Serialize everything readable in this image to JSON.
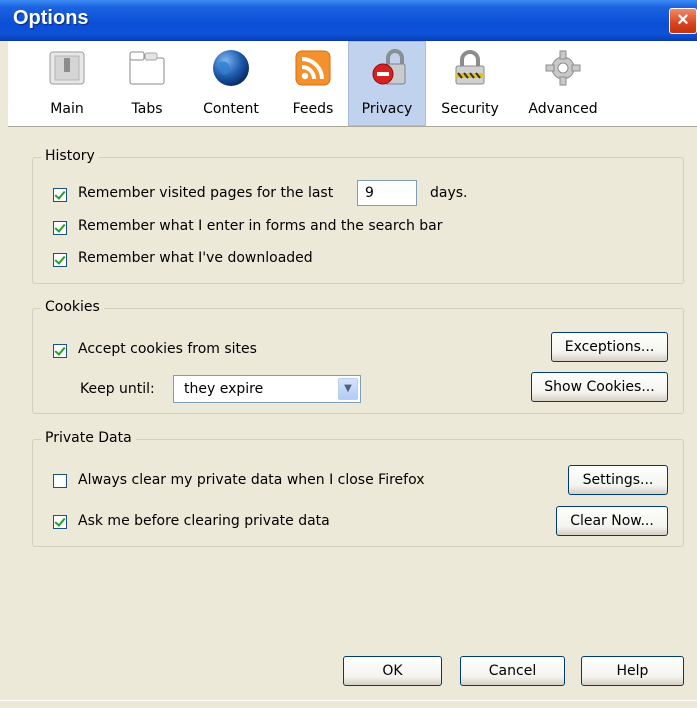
{
  "window": {
    "title": "Options",
    "close_glyph": "×"
  },
  "panes": [
    {
      "label": "Main",
      "icon": "switch-icon"
    },
    {
      "label": "Tabs",
      "icon": "tabs-icon"
    },
    {
      "label": "Content",
      "icon": "globe-icon"
    },
    {
      "label": "Feeds",
      "icon": "rss-icon"
    },
    {
      "label": "Privacy",
      "icon": "lock-icon",
      "selected": true
    },
    {
      "label": "Security",
      "icon": "padlock-icon"
    },
    {
      "label": "Advanced",
      "icon": "gear-icon"
    }
  ],
  "history": {
    "title": "History",
    "remember_visited_label": "Remember visited pages for the last",
    "days_value": "9",
    "days_suffix": "days.",
    "remember_forms_label": "Remember what I enter in forms and the search bar",
    "remember_downloads_label": "Remember what I've downloaded"
  },
  "cookies": {
    "title": "Cookies",
    "accept_label": "Accept cookies from sites",
    "keep_until_label": "Keep until:",
    "keep_until_value": "they expire",
    "exceptions_button": "Exceptions...",
    "show_cookies_button": "Show Cookies..."
  },
  "private_data": {
    "title": "Private Data",
    "always_clear_label": "Always clear my private data when I close Firefox",
    "ask_before_label": "Ask me before clearing private data",
    "settings_button": "Settings...",
    "clear_now_button": "Clear Now..."
  },
  "footer": {
    "ok": "OK",
    "cancel": "Cancel",
    "help": "Help"
  },
  "colors": {
    "selected_pane": "#c1d2ee",
    "dialog_bg": "#ece9d8",
    "title_bar": "#0a4fd6"
  }
}
